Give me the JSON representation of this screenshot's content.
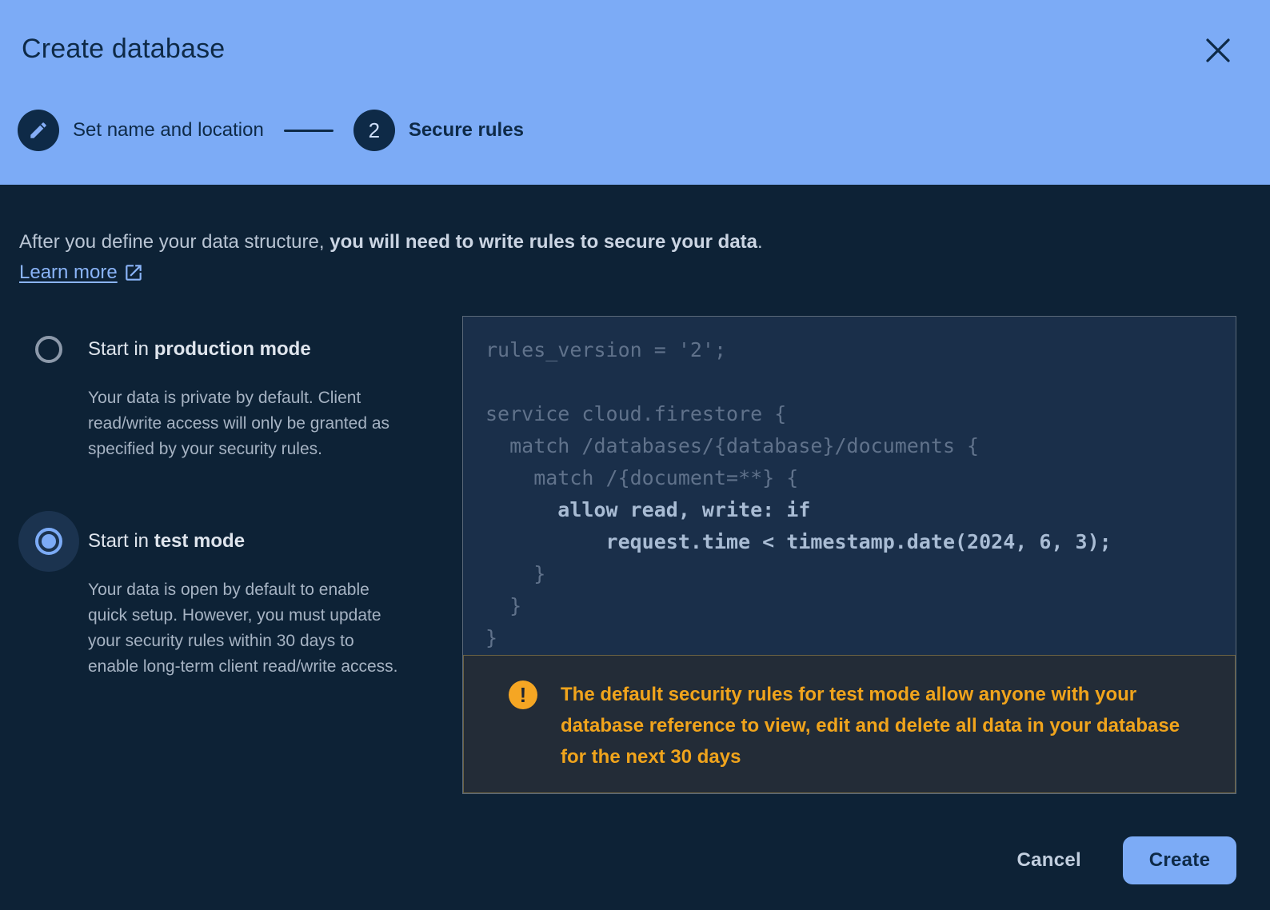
{
  "header": {
    "title": "Create database",
    "steps": [
      {
        "label": "Set name and location",
        "icon": "pencil-icon"
      },
      {
        "number": "2",
        "label": "Secure rules"
      }
    ]
  },
  "intro": {
    "text_regular": "After you define your data structure, ",
    "text_bold": "you will need to write rules to secure your data",
    "text_period": ".",
    "learn_more_label": "Learn more"
  },
  "options": [
    {
      "title_regular": "Start in ",
      "title_bold": "production mode",
      "selected": false,
      "description": "Your data is private by default. Client read/write access will only be granted as specified by your security rules."
    },
    {
      "title_regular": "Start in ",
      "title_bold": "test mode",
      "selected": true,
      "description": "Your data is open by default to enable quick setup. However, you must update your security rules within 30 days to enable long-term client read/write access."
    }
  ],
  "code_editor": {
    "lines": [
      {
        "text": "rules_version = '2';",
        "style": "dim"
      },
      {
        "text": "",
        "style": "dim"
      },
      {
        "text": "service cloud.firestore {",
        "style": "dim"
      },
      {
        "text": "  match /databases/{database}/documents {",
        "style": "dim"
      },
      {
        "text": "    match /{document=**} {",
        "style": "dim"
      },
      {
        "text": "      allow read, write: if",
        "style": "bright"
      },
      {
        "text": "          request.time < timestamp.date(2024, 6, 3);",
        "style": "bright"
      },
      {
        "text": "    }",
        "style": "dim"
      },
      {
        "text": "  }",
        "style": "dim"
      },
      {
        "text": "}",
        "style": "dim"
      }
    ]
  },
  "warning": {
    "icon": "exclamation-icon",
    "glyph": "!",
    "text": "The default security rules for test mode allow anyone with your database reference to view, edit and delete all data in your database for the next 30 days"
  },
  "footer": {
    "cancel_label": "Cancel",
    "create_label": "Create"
  },
  "colors": {
    "header_blue": "#7cabf6",
    "page_bg": "#0d2236",
    "navy_text": "#0e2a47",
    "panel_bg": "#1a2f4a",
    "panel_border": "#5a6878",
    "warning_bg": "#232c37",
    "warning_amber": "#f0a41c",
    "link_blue": "#8ab4f8",
    "accent_blue": "#7cabf6"
  }
}
